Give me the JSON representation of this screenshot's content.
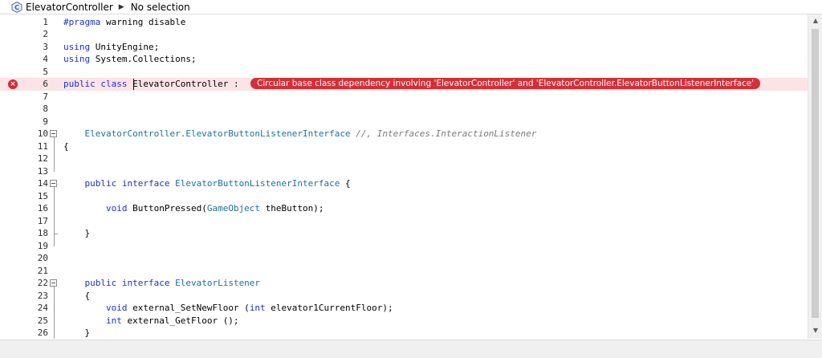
{
  "breadcrumb": {
    "icon": "class-c-icon",
    "file": "ElevatorController",
    "selection": "No selection"
  },
  "error": {
    "message": "Circular base class dependency involving 'ElevatorController' and 'ElevatorController.ElevatorButtonListenerInterface'",
    "line": 6
  },
  "lines": [
    {
      "n": "1",
      "parts": [
        {
          "t": "#pragma",
          "c": "kw"
        },
        {
          "t": " warning disable",
          "c": ""
        }
      ]
    },
    {
      "n": "2",
      "parts": []
    },
    {
      "n": "3",
      "parts": [
        {
          "t": "using",
          "c": "kw"
        },
        {
          "t": " UnityEngine;",
          "c": ""
        }
      ]
    },
    {
      "n": "4",
      "parts": [
        {
          "t": "using",
          "c": "kw"
        },
        {
          "t": " System.Collections;",
          "c": ""
        }
      ]
    },
    {
      "n": "5",
      "parts": []
    },
    {
      "n": "6",
      "parts": [
        {
          "t": "public",
          "c": "kw"
        },
        {
          "t": " ",
          "c": ""
        },
        {
          "t": "class",
          "c": "kw"
        },
        {
          "t": " ElevatorController :",
          "c": ""
        }
      ]
    },
    {
      "n": "7",
      "parts": []
    },
    {
      "n": "8",
      "parts": []
    },
    {
      "n": "9",
      "parts": []
    },
    {
      "n": "10",
      "parts": [
        {
          "t": "    ElevatorController.ElevatorButtonListenerInterface",
          "c": "ty"
        },
        {
          "t": " //, Interfaces.InteractionListener",
          "c": "cm"
        }
      ]
    },
    {
      "n": "11",
      "parts": [
        {
          "t": "{",
          "c": ""
        }
      ]
    },
    {
      "n": "12",
      "parts": []
    },
    {
      "n": "13",
      "parts": []
    },
    {
      "n": "14",
      "parts": [
        {
          "t": "    public",
          "c": "kw"
        },
        {
          "t": " ",
          "c": ""
        },
        {
          "t": "interface",
          "c": "kw"
        },
        {
          "t": " ",
          "c": ""
        },
        {
          "t": "ElevatorButtonListenerInterface",
          "c": "ty"
        },
        {
          "t": " {",
          "c": ""
        }
      ]
    },
    {
      "n": "15",
      "parts": []
    },
    {
      "n": "16",
      "parts": [
        {
          "t": "        void",
          "c": "kw"
        },
        {
          "t": " ButtonPressed(",
          "c": ""
        },
        {
          "t": "GameObject",
          "c": "ty"
        },
        {
          "t": " theButton);",
          "c": ""
        }
      ]
    },
    {
      "n": "17",
      "parts": []
    },
    {
      "n": "18",
      "parts": [
        {
          "t": "    }",
          "c": ""
        }
      ]
    },
    {
      "n": "19",
      "parts": []
    },
    {
      "n": "20",
      "parts": []
    },
    {
      "n": "21",
      "parts": []
    },
    {
      "n": "22",
      "parts": [
        {
          "t": "    public",
          "c": "kw"
        },
        {
          "t": " ",
          "c": ""
        },
        {
          "t": "interface",
          "c": "kw"
        },
        {
          "t": " ",
          "c": ""
        },
        {
          "t": "ElevatorListener",
          "c": "ty"
        }
      ]
    },
    {
      "n": "23",
      "parts": [
        {
          "t": "    {",
          "c": ""
        }
      ]
    },
    {
      "n": "24",
      "parts": [
        {
          "t": "        void",
          "c": "kw"
        },
        {
          "t": " external_SetNewFloor (",
          "c": ""
        },
        {
          "t": "int",
          "c": "kw"
        },
        {
          "t": " elevator1CurrentFloor);",
          "c": ""
        }
      ]
    },
    {
      "n": "25",
      "parts": [
        {
          "t": "        int",
          "c": "kw"
        },
        {
          "t": " external_GetFloor ();",
          "c": ""
        }
      ]
    },
    {
      "n": "26",
      "parts": [
        {
          "t": "    }",
          "c": ""
        }
      ]
    }
  ],
  "colors": {
    "keyword": "#1f2fd0",
    "type": "#1d6fa0",
    "comment": "#7a7a7a",
    "error": "#d62e38",
    "error_line_bg": "#fbe3e6"
  }
}
